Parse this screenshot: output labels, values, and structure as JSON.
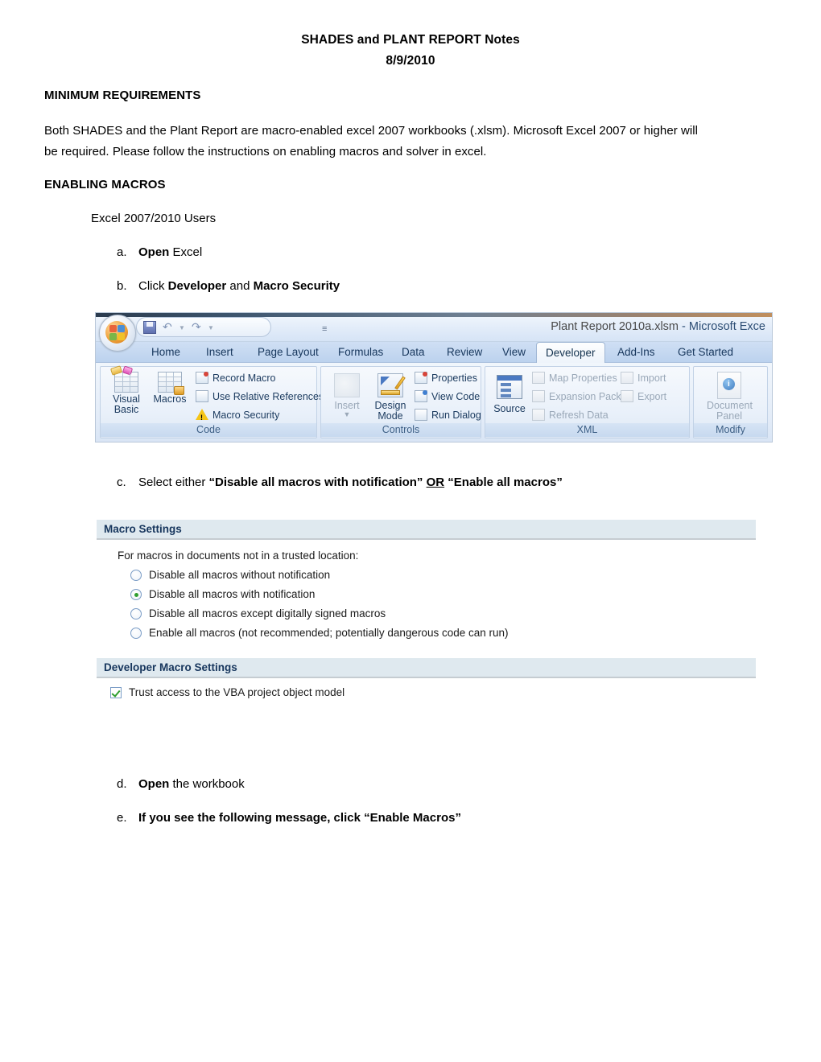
{
  "document": {
    "title_line1": "SHADES and PLANT REPORT Notes",
    "title_line2": "8/9/2010",
    "heading_minimum_requirements": "MINIMUM REQUIREMENTS",
    "intro_paragraph": "Both SHADES and the Plant Report are macro-enabled excel 2007 workbooks (.xlsm). Microsoft Excel 2007 or higher will be required. Please follow the instructions on enabling macros and solver in excel.",
    "heading_enabling_macros": "ENABLING MACROS",
    "subheading_users": "Excel 2007/2010 Users",
    "steps": [
      {
        "marker": "a.",
        "bold_lead": "Open",
        "rest": " Excel"
      },
      {
        "marker": "b.",
        "lead": "Click ",
        "bold_1": "Developer",
        "mid": " and ",
        "bold_2": "Macro Security"
      },
      {
        "marker": "c.",
        "lead": "Select either ",
        "bold_1": "“Disable all macros with notification”",
        "mid": " ",
        "underline": "OR",
        "bold_2": " “Enable all macros”"
      },
      {
        "marker": "d.",
        "bold_lead": "Open",
        "rest": " the workbook"
      },
      {
        "marker": "e.",
        "bold_all": "If you see the following message, click “Enable Macros”"
      }
    ]
  },
  "ribbon_screenshot": {
    "window_title_file": "Plant Report 2010a.xlsm",
    "window_title_sep": "  -  ",
    "window_title_app": "Microsoft Exce",
    "office_button": "office-orb",
    "quick_access": [
      "save-icon",
      "undo-icon",
      "redo-icon",
      "customize-icon"
    ],
    "tabs": [
      {
        "label": "Home",
        "active": false
      },
      {
        "label": "Insert",
        "active": false
      },
      {
        "label": "Page Layout",
        "active": false
      },
      {
        "label": "Formulas",
        "active": false
      },
      {
        "label": "Data",
        "active": false
      },
      {
        "label": "Review",
        "active": false
      },
      {
        "label": "View",
        "active": false
      },
      {
        "label": "Developer",
        "active": true
      },
      {
        "label": "Add-Ins",
        "active": false
      },
      {
        "label": "Get Started",
        "active": false
      }
    ],
    "groups": [
      {
        "name": "Code",
        "label": "Code",
        "big_buttons": [
          "Visual Basic",
          "Macros"
        ],
        "small_buttons": [
          "Record Macro",
          "Use Relative References",
          "Macro Security"
        ]
      },
      {
        "name": "Controls",
        "label": "Controls",
        "big_buttons": [
          "Insert",
          "Design Mode"
        ],
        "small_buttons": [
          "Properties",
          "View Code",
          "Run Dialog"
        ]
      },
      {
        "name": "XML",
        "label": "XML",
        "big_buttons": [
          "Source"
        ],
        "small_buttons": [
          "Map Properties",
          "Expansion Packs",
          "Refresh Data",
          "Import",
          "Export"
        ]
      },
      {
        "name": "Modify",
        "label": "Modify",
        "big_buttons": [
          "Document Panel"
        ],
        "small_buttons": []
      }
    ],
    "big_button_labels": {
      "visual_basic_1": "Visual",
      "visual_basic_2": "Basic",
      "macros": "Macros",
      "insert": "Insert",
      "design_1": "Design",
      "design_2": "Mode",
      "source": "Source",
      "document_1": "Document",
      "document_2": "Panel"
    },
    "small_button_labels": {
      "record_macro": "Record Macro",
      "use_relative_references": "Use Relative References",
      "macro_security": "Macro Security",
      "properties": "Properties",
      "view_code": "View Code",
      "run_dialog": "Run Dialog",
      "map_properties": "Map Properties",
      "expansion_packs": "Expansion Packs",
      "refresh_data": "Refresh Data",
      "import": "Import",
      "export": "Export"
    },
    "group_labels": {
      "code": "Code",
      "controls": "Controls",
      "xml": "XML",
      "modify": "Modify"
    }
  },
  "macro_settings_screenshot": {
    "section1_title": "Macro Settings",
    "section1_intro": "For macros in documents not in a trusted location:",
    "options": [
      {
        "label": "Disable all macros without notification",
        "selected": false
      },
      {
        "label": "Disable all macros with notification",
        "selected": true
      },
      {
        "label": "Disable all macros except digitally signed macros",
        "selected": false
      },
      {
        "label": "Enable all macros (not recommended; potentially dangerous code can run)",
        "selected": false
      }
    ],
    "section2_title": "Developer Macro Settings",
    "checkbox_label": "Trust access to the VBA project object model",
    "checkbox_checked": true
  },
  "colors": {
    "section_header_bg": "#dfe9ef",
    "section_header_text": "#17365d",
    "radio_selected_dot": "#2f9e2f",
    "checkbox_check": "#2f9e2f",
    "ribbon_tab_text": "#16365c",
    "ribbon_title_text": "#2c4d74"
  }
}
